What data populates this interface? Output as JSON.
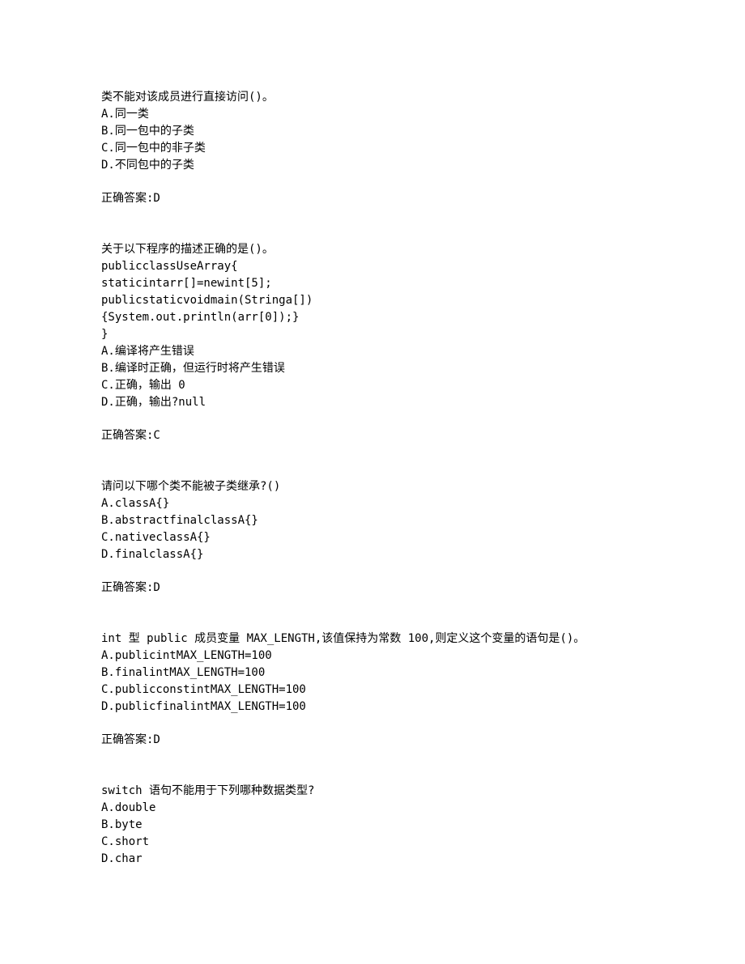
{
  "questions": [
    {
      "stem": "类不能对该成员进行直接访问()。",
      "options": [
        "A.同一类",
        "B.同一包中的子类",
        "C.同一包中的非子类",
        "D.不同包中的子类"
      ],
      "answer": "正确答案:D"
    },
    {
      "stem": "关于以下程序的描述正确的是()。",
      "code": [
        "publicclassUseArray{",
        "staticintarr[]=newint[5];",
        "publicstaticvoidmain(Stringa[])",
        "{System.out.println(arr[0]);}",
        "}"
      ],
      "options": [
        "A.编译将产生错误",
        "B.编译时正确，但运行时将产生错误",
        "C.正确，输出 0",
        "D.正确，输出?null"
      ],
      "answer": "正确答案:C"
    },
    {
      "stem": "请问以下哪个类不能被子类继承?()",
      "options": [
        "A.classA{}",
        "B.abstractfinalclassA{}",
        "C.nativeclassA{}",
        "D.finalclassA{}"
      ],
      "answer": "正确答案:D"
    },
    {
      "stem": "int 型 public 成员变量 MAX_LENGTH,该值保持为常数 100,则定义这个变量的语句是()。",
      "options": [
        "A.publicintMAX_LENGTH=100",
        "B.finalintMAX_LENGTH=100",
        "C.publicconstintMAX_LENGTH=100",
        "D.publicfinalintMAX_LENGTH=100"
      ],
      "answer": "正确答案:D"
    },
    {
      "stem": "switch 语句不能用于下列哪种数据类型?",
      "options": [
        "A.double",
        "B.byte",
        "C.short",
        "D.char"
      ]
    }
  ]
}
